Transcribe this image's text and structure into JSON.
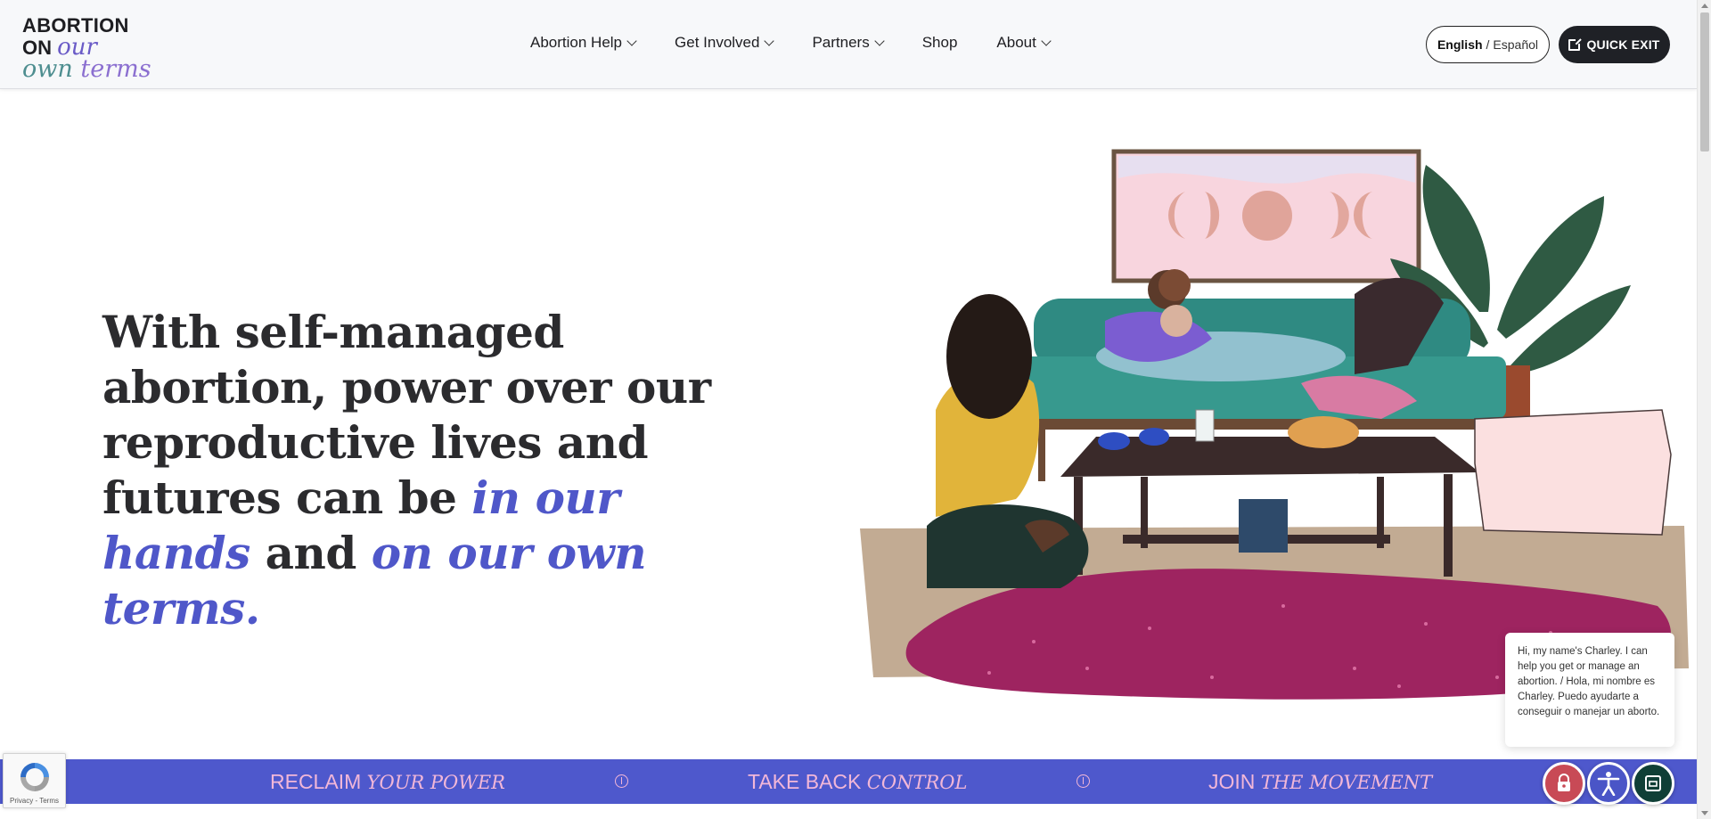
{
  "header": {
    "logo": {
      "line1": "ABORTION",
      "line2_a": "ON",
      "line2_b": "our",
      "line3_a": "own",
      "line3_b": "terms"
    },
    "nav": [
      {
        "label": "Abortion Help",
        "has_dropdown": true
      },
      {
        "label": "Get Involved",
        "has_dropdown": true
      },
      {
        "label": "Partners",
        "has_dropdown": true
      },
      {
        "label": "Shop",
        "has_dropdown": false
      },
      {
        "label": "About",
        "has_dropdown": true
      }
    ],
    "language": {
      "active": "English",
      "separator": "/",
      "other": "Español"
    },
    "quick_exit": {
      "label": "QUICK EXIT",
      "icon": "external-link-icon"
    }
  },
  "hero": {
    "part1": "With self-managed abortion, power over our reproductive lives and futures can be ",
    "em1": "in our hands",
    "part2": " and ",
    "em2": "on our own terms."
  },
  "banner": {
    "items": [
      {
        "plain": "RECLAIM ",
        "italic": "YOUR POWER"
      },
      {
        "plain": "TAKE BACK ",
        "italic": "CONTROL"
      },
      {
        "plain": "JOIN ",
        "italic": "THE MOVEMENT"
      }
    ],
    "separator_icon": "circle-line-icon"
  },
  "chat": {
    "message": "Hi, my name's Charley. I can help you get or manage an abortion. / Hola, mi nombre es Charley. Puedo ayudarte a conseguir o manejar un aborto."
  },
  "floating_buttons": [
    {
      "icon": "lock-icon",
      "color": "#c84a56"
    },
    {
      "icon": "accessibility-icon",
      "color": "#4a55c7"
    },
    {
      "icon": "chat-icon",
      "color": "#0f3f36"
    }
  ],
  "recaptcha": {
    "terms": "Privacy - Terms"
  },
  "colors": {
    "accent": "#4f57c9",
    "banner_bg": "#4e58cc",
    "banner_text": "#f2b7d8",
    "dark_button": "#1f2126"
  }
}
